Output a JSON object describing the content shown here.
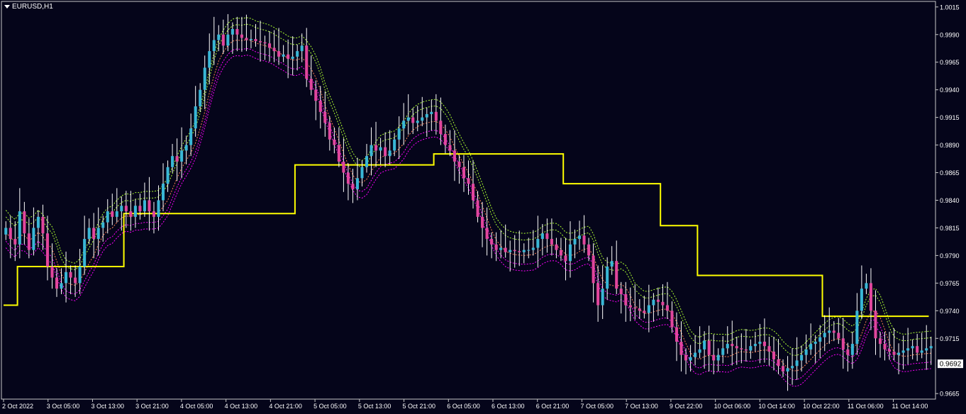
{
  "window": {
    "symbol_label": "EURUSD,H1",
    "current_price": "0.9692",
    "colors": {
      "background": "#05051a",
      "frame": "#c8c8c8",
      "text": "#ffffff",
      "bull_candle": "#39b7d6",
      "bear_candle": "#e1469d",
      "wick": "#ffffff",
      "step_line": "#ffff00",
      "upper_band": "#adff2f",
      "lower_band": "#ff00ff",
      "mid_band": "#ff7f50"
    }
  },
  "chart_data": {
    "type": "candlestick",
    "y_ticks": [
      "1.0015",
      "0.9990",
      "0.9965",
      "0.9940",
      "0.9915",
      "0.9890",
      "0.9865",
      "0.9840",
      "0.9815",
      "0.9790",
      "0.9765",
      "0.9740",
      "0.9715",
      "0.9692",
      "0.9665"
    ],
    "ylim": [
      0.966,
      1.002
    ],
    "x_ticks": [
      "2 Oct 2022",
      "3 Oct 05:00",
      "3 Oct 13:00",
      "3 Oct 21:00",
      "4 Oct 05:00",
      "4 Oct 13:00",
      "4 Oct 21:00",
      "5 Oct 05:00",
      "5 Oct 13:00",
      "5 Oct 21:00",
      "6 Oct 05:00",
      "6 Oct 13:00",
      "6 Oct 21:00",
      "7 Oct 05:00",
      "7 Oct 13:00",
      "9 Oct 22:00",
      "10 Oct 06:00",
      "10 Oct 14:00",
      "10 Oct 22:00",
      "11 Oct 06:00",
      "11 Oct 14:00"
    ],
    "candle_count": 200,
    "close_series": [
      0.9815,
      0.9805,
      0.98,
      0.983,
      0.981,
      0.9795,
      0.9815,
      0.9825,
      0.981,
      0.978,
      0.977,
      0.976,
      0.9765,
      0.9775,
      0.977,
      0.9765,
      0.978,
      0.9805,
      0.9815,
      0.9805,
      0.9815,
      0.982,
      0.983,
      0.9825,
      0.983,
      0.9835,
      0.983,
      0.9825,
      0.9835,
      0.983,
      0.984,
      0.983,
      0.9825,
      0.984,
      0.9855,
      0.987,
      0.988,
      0.9875,
      0.9885,
      0.989,
      0.9905,
      0.9925,
      0.994,
      0.996,
      0.9975,
      0.9985,
      0.999,
      0.998,
      0.999,
      0.9995,
      0.999,
      0.9987,
      0.9985,
      0.9986,
      0.9984,
      0.9983,
      0.9982,
      0.9978,
      0.9975,
      0.997,
      0.9972,
      0.9968,
      0.997,
      0.9975,
      0.998,
      0.995,
      0.994,
      0.993,
      0.992,
      0.991,
      0.9895,
      0.989,
      0.9875,
      0.9865,
      0.9855,
      0.985,
      0.986,
      0.987,
      0.988,
      0.989,
      0.9885,
      0.9888,
      0.988,
      0.9885,
      0.9895,
      0.9905,
      0.9912,
      0.9915,
      0.991,
      0.9912,
      0.9915,
      0.9918,
      0.992,
      0.9912,
      0.99,
      0.989,
      0.9885,
      0.9875,
      0.987,
      0.986,
      0.9855,
      0.984,
      0.9825,
      0.9815,
      0.9805,
      0.98,
      0.9795,
      0.9797,
      0.9793,
      0.9795,
      0.9794,
      0.9793,
      0.9795,
      0.9795,
      0.9797,
      0.9805,
      0.981,
      0.9805,
      0.98,
      0.9795,
      0.979,
      0.9785,
      0.98,
      0.9805,
      0.9808,
      0.98,
      0.979,
      0.9765,
      0.9745,
      0.976,
      0.978,
      0.9785,
      0.976,
      0.9755,
      0.9745,
      0.9743,
      0.9742,
      0.974,
      0.9738,
      0.9745,
      0.975,
      0.9748,
      0.9745,
      0.974,
      0.9725,
      0.9712,
      0.97,
      0.9695,
      0.9698,
      0.9702,
      0.9705,
      0.9713,
      0.97,
      0.9695,
      0.97,
      0.9706,
      0.971,
      0.9708,
      0.9706,
      0.9705,
      0.9704,
      0.9708,
      0.971,
      0.9712,
      0.9708,
      0.9703,
      0.9696,
      0.969,
      0.9685,
      0.9688,
      0.969,
      0.9695,
      0.97,
      0.9705,
      0.971,
      0.9712,
      0.9716,
      0.972,
      0.9722,
      0.972,
      0.9715,
      0.9705,
      0.97,
      0.971,
      0.974,
      0.976,
      0.9765,
      0.974,
      0.9715,
      0.971,
      0.9705,
      0.9703,
      0.97,
      0.9702,
      0.9704,
      0.9706,
      0.9708,
      0.9702,
      0.9704,
      0.9706,
      0.9708
    ],
    "step_levels": [
      {
        "from": 0,
        "to": 2,
        "value": 0.9745
      },
      {
        "from": 3,
        "to": 25,
        "value": 0.978
      },
      {
        "from": 26,
        "to": 62,
        "value": 0.9828
      },
      {
        "from": 63,
        "to": 92,
        "value": 0.9872
      },
      {
        "from": 93,
        "to": 120,
        "value": 0.9882
      },
      {
        "from": 121,
        "to": 141,
        "value": 0.9855
      },
      {
        "from": 142,
        "to": 149,
        "value": 0.9817
      },
      {
        "from": 150,
        "to": 176,
        "value": 0.9772
      },
      {
        "from": 177,
        "to": 199,
        "value": 0.9735
      }
    ]
  }
}
